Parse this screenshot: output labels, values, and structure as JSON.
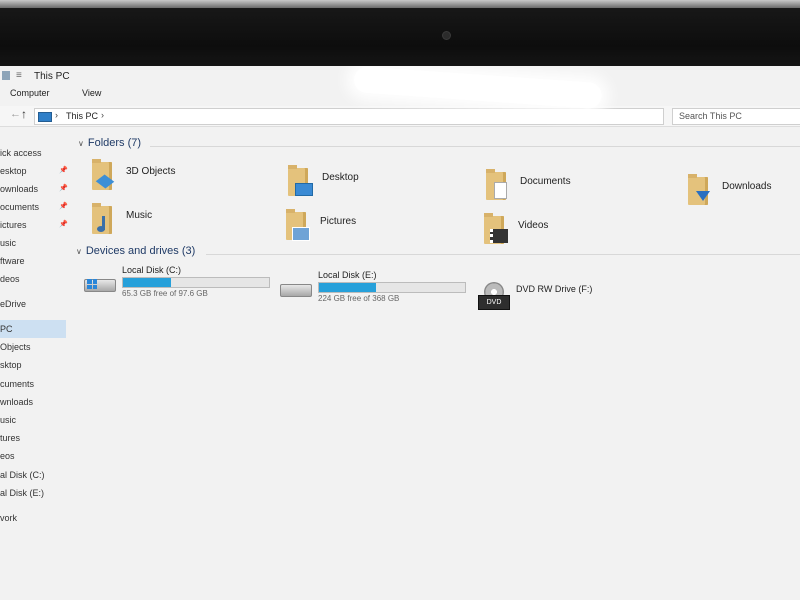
{
  "window": {
    "title": "This PC"
  },
  "ribbon": {
    "tabs": [
      "Computer",
      "View"
    ]
  },
  "address": {
    "path": "This PC",
    "search_placeholder": "Search This PC"
  },
  "sidebar": {
    "items": [
      {
        "label": "ick access",
        "pinned": false
      },
      {
        "label": "esktop",
        "pinned": true
      },
      {
        "label": "ownloads",
        "pinned": true
      },
      {
        "label": "ocuments",
        "pinned": true
      },
      {
        "label": "ictures",
        "pinned": true
      },
      {
        "label": "usic",
        "pinned": false
      },
      {
        "label": "ftware",
        "pinned": false
      },
      {
        "label": "deos",
        "pinned": false
      },
      {
        "label": "eDrive",
        "pinned": false
      },
      {
        "label": "PC",
        "pinned": false,
        "selected": true
      },
      {
        "label": "Objects",
        "pinned": false
      },
      {
        "label": "sktop",
        "pinned": false
      },
      {
        "label": "cuments",
        "pinned": false
      },
      {
        "label": "wnloads",
        "pinned": false
      },
      {
        "label": "usic",
        "pinned": false
      },
      {
        "label": "tures",
        "pinned": false
      },
      {
        "label": "eos",
        "pinned": false
      },
      {
        "label": "al Disk (C:)",
        "pinned": false
      },
      {
        "label": "al Disk (E:)",
        "pinned": false
      },
      {
        "label": "vork",
        "pinned": false
      }
    ]
  },
  "folders": {
    "header": "Folders (7)",
    "items": [
      {
        "name": "3D Objects",
        "icon": "3d-objects-folder-icon"
      },
      {
        "name": "Desktop",
        "icon": "desktop-folder-icon"
      },
      {
        "name": "Documents",
        "icon": "documents-folder-icon"
      },
      {
        "name": "Downloads",
        "icon": "downloads-folder-icon"
      },
      {
        "name": "Music",
        "icon": "music-folder-icon"
      },
      {
        "name": "Pictures",
        "icon": "pictures-folder-icon"
      },
      {
        "name": "Videos",
        "icon": "videos-folder-icon"
      }
    ]
  },
  "drives": {
    "header": "Devices and drives (3)",
    "items": [
      {
        "name": "Local Disk (C:)",
        "free": "65.3 GB free of 97.6 GB",
        "used_fraction": 0.33
      },
      {
        "name": "Local Disk (E:)",
        "free": "224 GB free of 368 GB",
        "used_fraction": 0.39
      },
      {
        "name": "DVD RW Drive (F:)",
        "free": "",
        "badge": "DVD"
      }
    ]
  },
  "colors": {
    "accent": "#26a0da",
    "folder": "#e4c27c",
    "selection": "#cde0f2"
  }
}
